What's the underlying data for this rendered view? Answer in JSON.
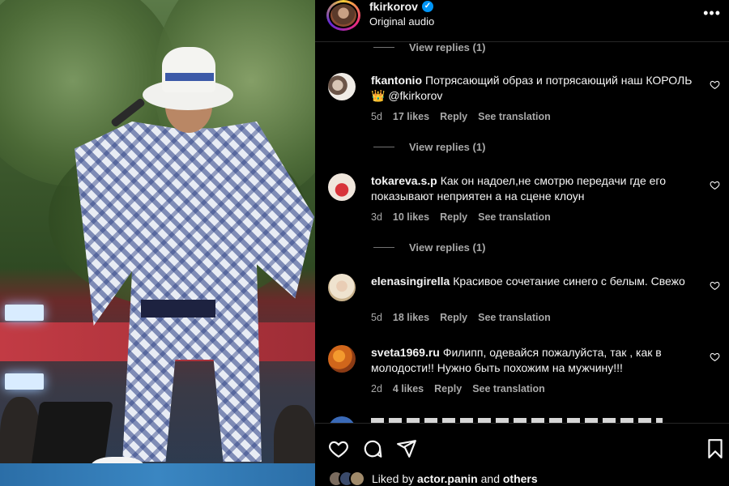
{
  "header": {
    "username": "fkirkorov",
    "subtitle": "Original audio",
    "verified_icon": "verified-badge-icon",
    "more_icon": "more-options-icon",
    "more_glyph": "•••"
  },
  "comments": [
    {
      "username": "fkantonio",
      "text": "Потрясающий образ и потрясающий наш КОРОЛЬ 👑 @fkirkorov",
      "age": "5d",
      "likes": "17 likes",
      "reply": "Reply",
      "translate": "See translation",
      "view_replies": "View replies (1)"
    },
    {
      "username": "tokareva.s.p",
      "text": "Как он надоел,не смотрю передачи где его показывают неприятен а на сцене клоун",
      "age": "3d",
      "likes": "10 likes",
      "reply": "Reply",
      "translate": "See translation",
      "view_replies": "View replies (1)"
    },
    {
      "username": "elenasingirella",
      "text": "Красивое сочетание синего с белым. Свежо",
      "age": "5d",
      "likes": "18 likes",
      "reply": "Reply",
      "translate": "See translation"
    },
    {
      "username": "sveta1969.ru",
      "text": "Филипп, одевайся пожалуйста, так , как в молодости!! Нужно быть похожим на мужчину!!!",
      "age": "2d",
      "likes": "4 likes",
      "reply": "Reply",
      "translate": "See translation"
    }
  ],
  "top_partial_replies": "View replies (1)",
  "actions": {
    "like_icon": "heart-icon",
    "comment_icon": "comment-icon",
    "share_icon": "share-icon",
    "save_icon": "bookmark-icon"
  },
  "liked_by": {
    "prefix": "Liked by",
    "user": "actor.panin",
    "and": "and",
    "others": "others"
  },
  "colors": {
    "background": "#000000",
    "text": "#f5f5f5",
    "secondary": "#a8a8a8",
    "verified": "#0095f6"
  }
}
